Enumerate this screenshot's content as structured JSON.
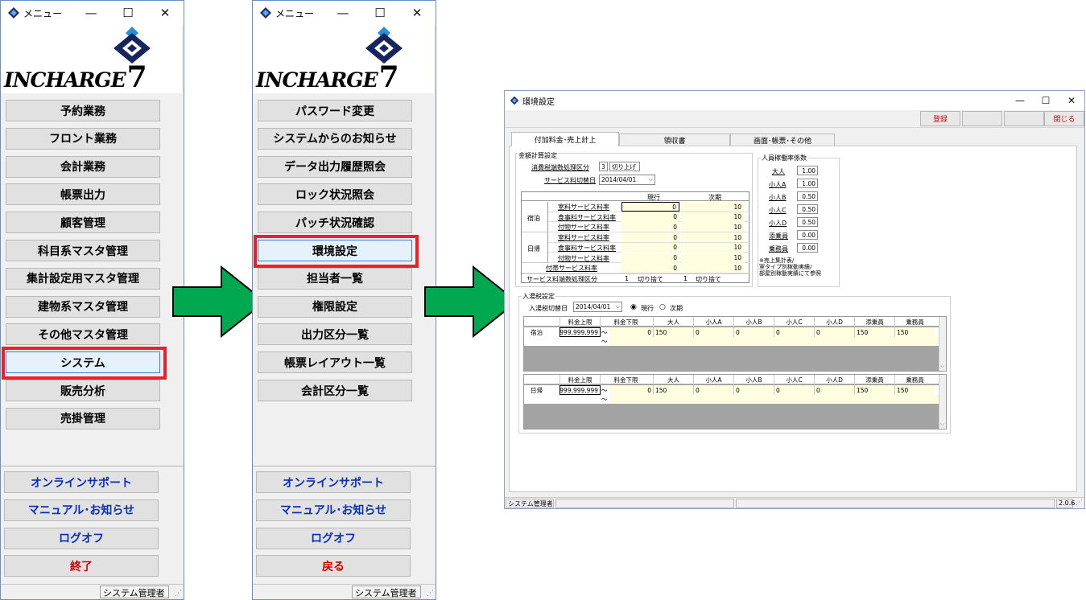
{
  "menu1": {
    "title": "メニュー",
    "brand": "INCHARGE",
    "brand_num": "7",
    "buttons": [
      "予約業務",
      "フロント業務",
      "会計業務",
      "帳票出力",
      "顧客管理",
      "科目系マスタ管理",
      "集計設定用マスタ管理",
      "建物系マスタ管理",
      "その他マスタ管理",
      "システム",
      "販売分析",
      "売掛管理"
    ],
    "footer": [
      "オンラインサポート",
      "マニュアル･お知らせ",
      "ログオフ",
      "終了"
    ],
    "status": "システム管理者"
  },
  "menu2": {
    "title": "メニュー",
    "brand": "INCHARGE",
    "brand_num": "7",
    "buttons": [
      "パスワード変更",
      "システムからのお知らせ",
      "データ出力履歴照会",
      "ロック状況照会",
      "パッチ状況確認",
      "環境設定",
      "担当者一覧",
      "権限設定",
      "出力区分一覧",
      "帳票レイアウト一覧",
      "会計区分一覧"
    ],
    "footer": [
      "オンラインサポート",
      "マニュアル･お知らせ",
      "ログオフ",
      "戻る"
    ],
    "status": "システム管理者"
  },
  "settings": {
    "title": "環境設定",
    "toolbar": {
      "register": "登録",
      "close": "閉じる"
    },
    "tabs": [
      "付加料金･売上計上",
      "領収書",
      "画面･帳票･その他"
    ],
    "kingaku": {
      "group": "金額計算設定",
      "tax_label": "消費税端数処理区分",
      "tax_code": "3",
      "tax_value": "切り上げ",
      "svc_date_label": "サービス料切替日",
      "svc_date": "2014/04/01",
      "col_current": "現行",
      "col_next": "次期",
      "grp_stay": "宿泊",
      "grp_day": "日帰",
      "rows": [
        {
          "label": "室料サービス料率",
          "cur": "0",
          "next": "10"
        },
        {
          "label": "食事料サービス料率",
          "cur": "0",
          "next": "10"
        },
        {
          "label": "付物サービス料率",
          "cur": "0",
          "next": "10"
        },
        {
          "label": "室料サービス料率",
          "cur": "0",
          "next": "10"
        },
        {
          "label": "食事料サービス料率",
          "cur": "0",
          "next": "10"
        },
        {
          "label": "付物サービス料率",
          "cur": "0",
          "next": "10"
        },
        {
          "label": "付帯サービス料率",
          "cur": "0",
          "next": "10"
        }
      ],
      "round_label": "サービス料端数処理区分",
      "round_cur_code": "1",
      "round_cur": "切り捨て",
      "round_next_code": "1",
      "round_next": "切り捨て"
    },
    "jinin": {
      "group": "人員稼働率係数",
      "rows": [
        {
          "label": "大人",
          "value": "1.00"
        },
        {
          "label": "小人A",
          "value": "1.00"
        },
        {
          "label": "小人B",
          "value": "0.50"
        },
        {
          "label": "小人C",
          "value": "0.50"
        },
        {
          "label": "小人D",
          "value": "0.50"
        },
        {
          "label": "添乗員",
          "value": "0.00"
        },
        {
          "label": "乗務員",
          "value": "0.00"
        }
      ],
      "note": [
        "※売上集計表/",
        "室タイプ別稼動実績/",
        "部屋別稼動実績にて参照"
      ]
    },
    "nyuto": {
      "group": "入湯税設定",
      "date_label": "入湯税切替日",
      "date": "2014/04/01",
      "radio_current": "現行",
      "radio_next": "次期",
      "headers": [
        "料金上限",
        "料金下限",
        "大人",
        "小人A",
        "小人B",
        "小人C",
        "小人D",
        "添乗員",
        "乗務員"
      ],
      "tilde": "～",
      "stay": {
        "label": "宿泊",
        "upper": "999,999,999",
        "lower": "0",
        "vals": [
          "150",
          "0",
          "0",
          "0",
          "0",
          "150",
          "150"
        ]
      },
      "day": {
        "label": "日帰",
        "upper": "999,999,999",
        "lower": "0",
        "vals": [
          "150",
          "0",
          "0",
          "0",
          "0",
          "150",
          "150"
        ]
      }
    },
    "status": {
      "user": "システム管理者",
      "version": "2.0.6"
    }
  },
  "colors": {
    "highlight": "#e8202b",
    "arrow_fill": "#00a84f",
    "title_blue": "#0a2fb0",
    "end_red": "#d40000"
  }
}
